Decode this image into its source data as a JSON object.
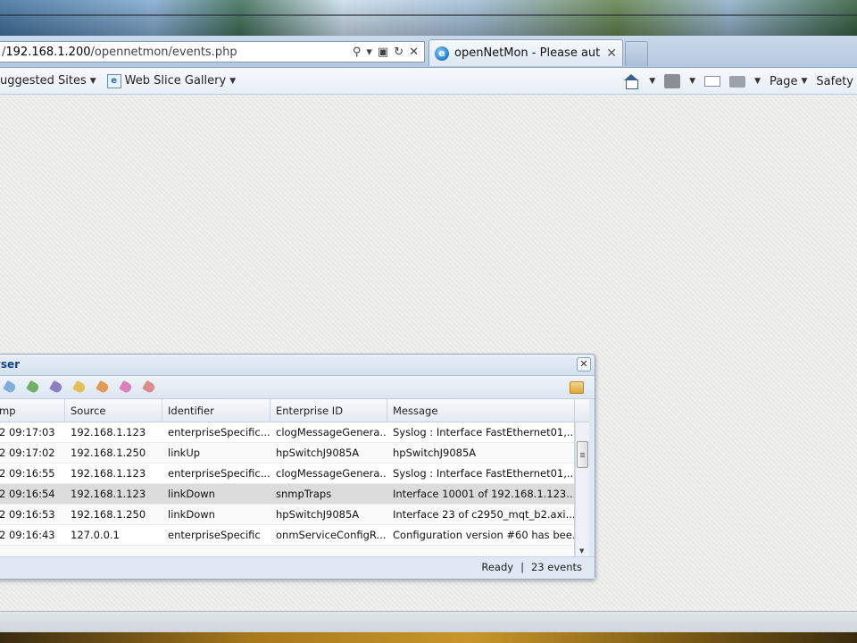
{
  "browser": {
    "address": {
      "prefix": "/",
      "host": "192.168.1.200",
      "path": "/opennetmon/events.php"
    },
    "address_tools": {
      "search": "⚲",
      "dropdown": "▾",
      "compat": "▣",
      "refresh": "↻",
      "stop": "✕"
    },
    "tab": {
      "title": "openNetMon - Please auth...",
      "close": "✕",
      "icon_letter": "e"
    }
  },
  "command_bar": {
    "suggested_sites": "uggested Sites",
    "web_slice_gallery": "Web Slice Gallery",
    "web_slice_icon_letter": "e",
    "page_menu": "Page",
    "safety_menu": "Safety"
  },
  "events_window": {
    "title": "vser",
    "close": "✕",
    "tag_colors": [
      "#6fa3d8",
      "#5aa34a",
      "#7b6bb8",
      "#e3b53c",
      "#e08a3c",
      "#d96fb0",
      "#d97a7a"
    ],
    "columns": [
      "mp",
      "Source",
      "Identifier",
      "Enterprise ID",
      "Message"
    ],
    "rows": [
      {
        "time": "2 09:17:03",
        "source": "192.168.1.123",
        "identifier": "enterpriseSpecific...",
        "enterprise_id": "clogMessageGenera...",
        "message": "Syslog : Interface FastEthernet01,..."
      },
      {
        "time": "2 09:17:02",
        "source": "192.168.1.250",
        "identifier": "linkUp",
        "enterprise_id": "hpSwitchJ9085A",
        "message": "hpSwitchJ9085A"
      },
      {
        "time": "2 09:16:55",
        "source": "192.168.1.123",
        "identifier": "enterpriseSpecific...",
        "enterprise_id": "clogMessageGenera...",
        "message": "Syslog : Interface FastEthernet01,..."
      },
      {
        "time": "2 09:16:54",
        "source": "192.168.1.123",
        "identifier": "linkDown",
        "enterprise_id": "snmpTraps",
        "message": "Interface 10001 of 192.168.1.123..."
      },
      {
        "time": "2 09:16:53",
        "source": "192.168.1.250",
        "identifier": "linkDown",
        "enterprise_id": "hpSwitchJ9085A",
        "message": "Interface 23 of c2950_mqt_b2.axi..."
      },
      {
        "time": "2 09:16:43",
        "source": "127.0.0.1",
        "identifier": "enterpriseSpecific",
        "enterprise_id": "onmServiceConfigR...",
        "message": "Configuration version #60 has bee..."
      }
    ],
    "selected_row": 3,
    "status": {
      "ready": "Ready",
      "separator": "|",
      "count": "23 events"
    }
  }
}
